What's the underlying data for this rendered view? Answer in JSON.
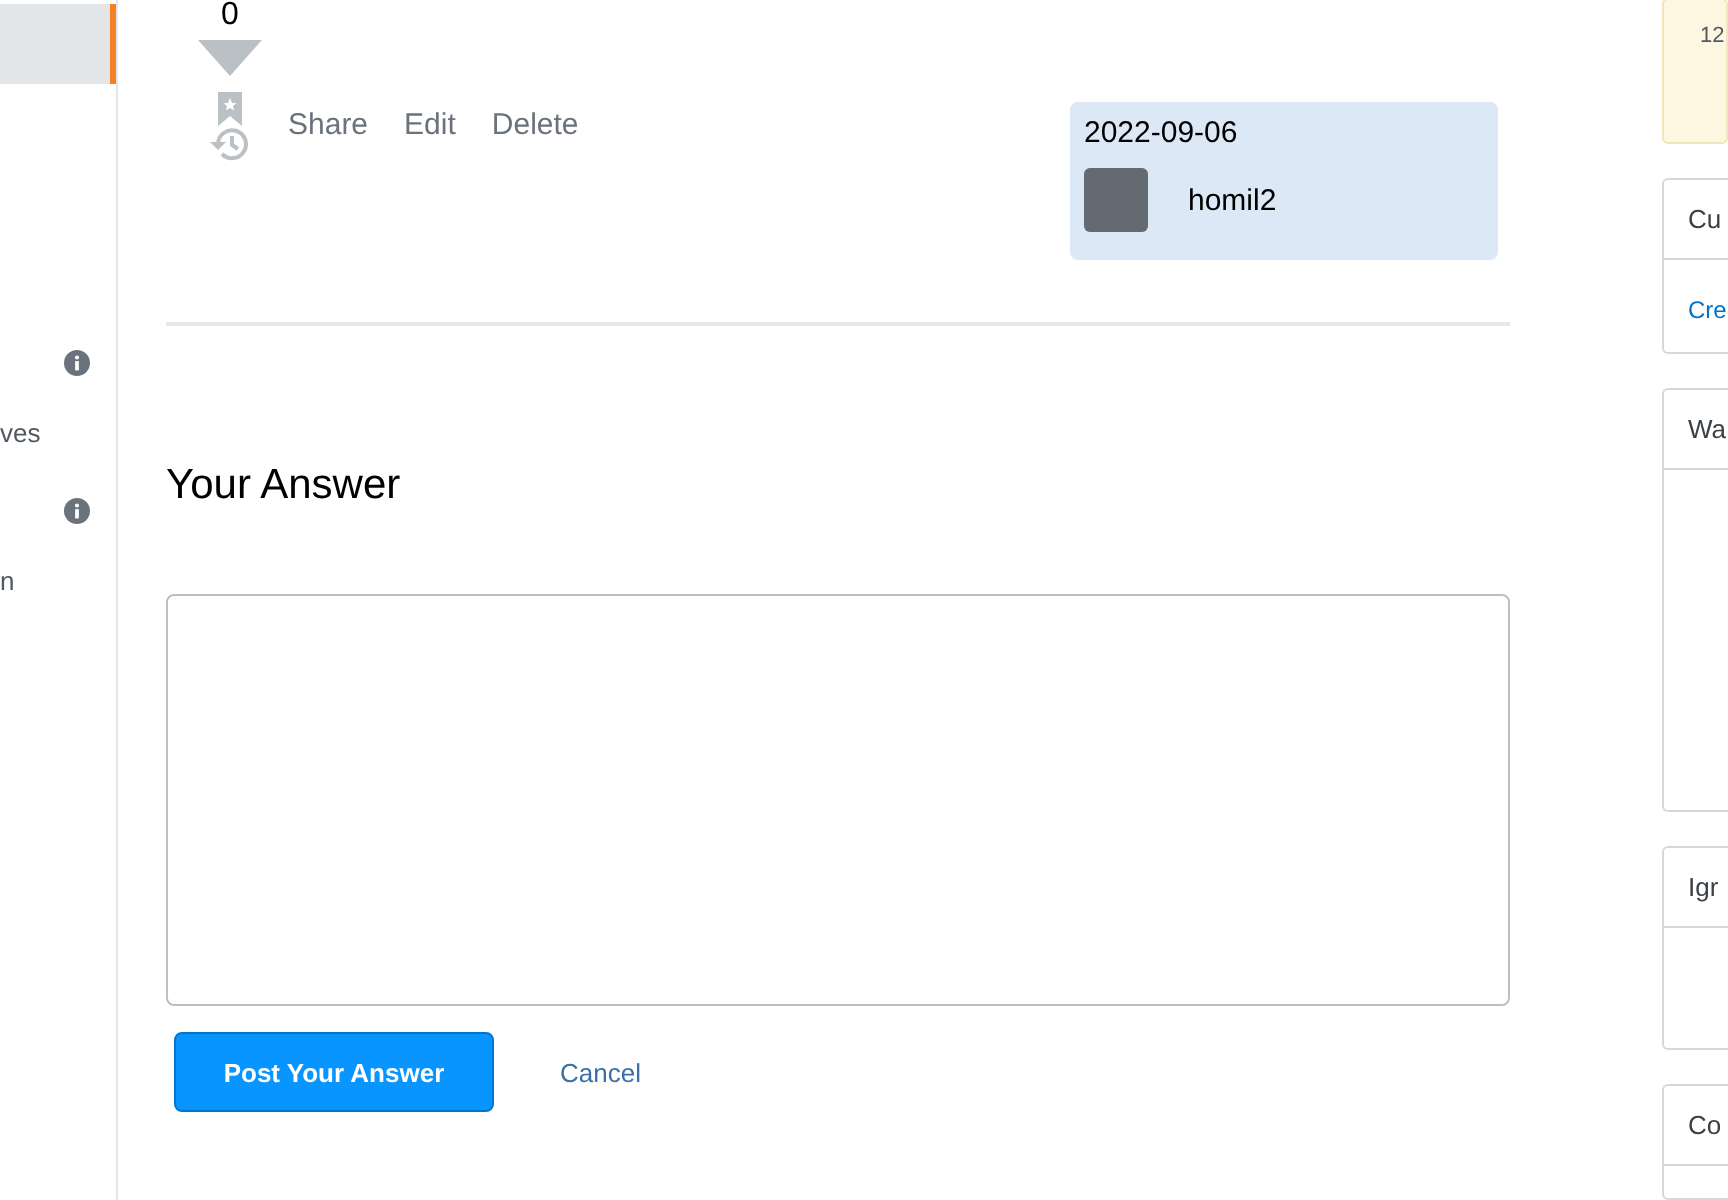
{
  "sidebar": {
    "items": [
      {
        "kind": "selected-tab",
        "selected": true
      },
      {
        "kind": "info"
      },
      {
        "kind": "text",
        "label": "ves"
      },
      {
        "kind": "info"
      },
      {
        "kind": "text",
        "label": "n"
      }
    ]
  },
  "post": {
    "score": "0",
    "actions": [
      "Share",
      "Edit",
      "Delete"
    ],
    "user_card": {
      "date": "2022-09-06",
      "username": "homil2"
    }
  },
  "answer": {
    "heading": "Your Answer",
    "submit": "Post Your Answer",
    "cancel": "Cancel"
  },
  "right_sidebar": [
    {
      "kind": "notice",
      "body": "12"
    },
    {
      "kind": "card",
      "header": "Cu",
      "body": "Cre"
    },
    {
      "kind": "card",
      "header": "Wa"
    },
    {
      "kind": "card",
      "header": "Igr"
    },
    {
      "kind": "card",
      "header": "Co"
    }
  ]
}
